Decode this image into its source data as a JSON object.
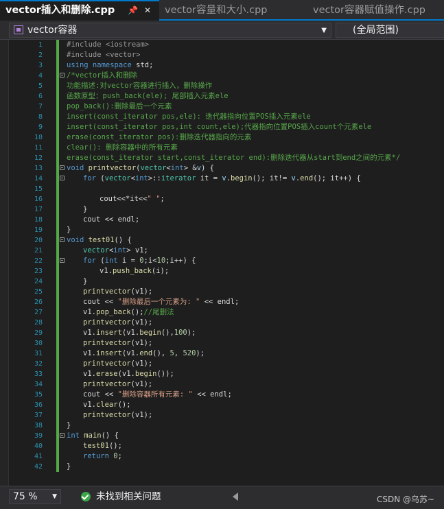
{
  "tabs": [
    {
      "label": "vector插入和删除.cpp",
      "active": true
    },
    {
      "label": "vector容量和大小.cpp",
      "active": false
    },
    {
      "label": "vector容器赋值操作.cpp",
      "active": false
    }
  ],
  "tab_icons": {
    "pin": "pin-icon",
    "close": "close-icon"
  },
  "nav": {
    "scope": "vector容器",
    "scope_icon": "project-icon",
    "global_scope": "(全局范围)"
  },
  "code": {
    "lines": [
      {
        "n": "1",
        "tokens": [
          [
            "pp",
            "#include <iostream>"
          ]
        ]
      },
      {
        "n": "2",
        "tokens": [
          [
            "pp",
            "#include <vector>"
          ]
        ]
      },
      {
        "n": "3",
        "tokens": [
          [
            "kw",
            "using namespace "
          ],
          [
            "",
            "std;"
          ]
        ]
      },
      {
        "n": "4",
        "fold": true,
        "tokens": [
          [
            "cm",
            "/*vector插入和删除"
          ]
        ]
      },
      {
        "n": "5",
        "tokens": [
          [
            "cm",
            "功能描述:对vector容器进行插入，删除操作"
          ]
        ]
      },
      {
        "n": "6",
        "tokens": [
          [
            "cm",
            "函数原型：push_back(ele); 尾部插入元素ele"
          ]
        ]
      },
      {
        "n": "7",
        "tokens": [
          [
            "cm",
            "pop_back():删除最后一个元素"
          ]
        ]
      },
      {
        "n": "8",
        "tokens": [
          [
            "cm",
            "insert(const_iterator pos,ele): 迭代器指向位置POS插入元素ele"
          ]
        ]
      },
      {
        "n": "9",
        "tokens": [
          [
            "cm",
            "insert(const_iterator pos,int count,ele);代器指向位置POS插入count个元素ele"
          ]
        ]
      },
      {
        "n": "10",
        "tokens": [
          [
            "cm",
            "erase(const_iterator pos):删除迭代器指向的元素"
          ]
        ]
      },
      {
        "n": "11",
        "tokens": [
          [
            "cm",
            "clear(): 删除容器中的所有元素"
          ]
        ]
      },
      {
        "n": "12",
        "tokens": [
          [
            "cm",
            "erase(const_iterator start,const_iterator end):删除迭代器从start到end之间的元素*/"
          ]
        ]
      },
      {
        "n": "13",
        "fold": true,
        "tokens": [
          [
            "kw",
            "void "
          ],
          [
            "fn",
            "printvector"
          ],
          [
            "",
            "("
          ],
          [
            "ty",
            "vector"
          ],
          [
            "",
            "<"
          ],
          [
            "kw",
            "int"
          ],
          [
            "",
            "> &"
          ],
          [
            "vr",
            "v"
          ],
          [
            "",
            ") {"
          ]
        ]
      },
      {
        "n": "14",
        "fold": true,
        "indent": 1,
        "tokens": [
          [
            "kw",
            "for "
          ],
          [
            "",
            "("
          ],
          [
            "ty",
            "vector"
          ],
          [
            "",
            "<"
          ],
          [
            "kw",
            "int"
          ],
          [
            "",
            ">::"
          ],
          [
            "ty",
            "iterator "
          ],
          [
            "",
            "it = "
          ],
          [
            "vr",
            "v"
          ],
          [
            "",
            "."
          ],
          [
            "fn",
            "begin"
          ],
          [
            "",
            "(); it!= "
          ],
          [
            "vr",
            "v"
          ],
          [
            "",
            "."
          ],
          [
            "fn",
            "end"
          ],
          [
            "",
            "(); it++) {"
          ]
        ]
      },
      {
        "n": "15",
        "tokens": []
      },
      {
        "n": "16",
        "indent": 2,
        "tokens": [
          [
            "",
            "cout<<*it<<"
          ],
          [
            "st",
            "\" \""
          ],
          [
            "",
            ";"
          ]
        ]
      },
      {
        "n": "17",
        "indent": 1,
        "tokens": [
          [
            "",
            "}"
          ]
        ]
      },
      {
        "n": "18",
        "indent": 1,
        "tokens": [
          [
            "",
            "cout << endl;"
          ]
        ]
      },
      {
        "n": "19",
        "tokens": [
          [
            "",
            "}"
          ]
        ]
      },
      {
        "n": "20",
        "fold": true,
        "tokens": [
          [
            "kw",
            "void "
          ],
          [
            "fn",
            "test01"
          ],
          [
            "",
            "() {"
          ]
        ]
      },
      {
        "n": "21",
        "indent": 1,
        "tokens": [
          [
            "ty",
            "vector"
          ],
          [
            "",
            "<"
          ],
          [
            "kw",
            "int"
          ],
          [
            "",
            "> v1;"
          ]
        ]
      },
      {
        "n": "22",
        "fold": true,
        "indent": 1,
        "tokens": [
          [
            "kw",
            "for "
          ],
          [
            "",
            "("
          ],
          [
            "kw",
            "int "
          ],
          [
            "",
            "i = "
          ],
          [
            "nm",
            "0"
          ],
          [
            "",
            ";i<"
          ],
          [
            "nm",
            "10"
          ],
          [
            "",
            ";i++) {"
          ]
        ]
      },
      {
        "n": "23",
        "indent": 2,
        "tokens": [
          [
            "",
            "v1."
          ],
          [
            "fn",
            "push_back"
          ],
          [
            "",
            "(i);"
          ]
        ]
      },
      {
        "n": "24",
        "indent": 1,
        "tokens": [
          [
            "",
            "}"
          ]
        ]
      },
      {
        "n": "25",
        "indent": 1,
        "tokens": [
          [
            "fn",
            "printvector"
          ],
          [
            "",
            "(v1);"
          ]
        ]
      },
      {
        "n": "26",
        "indent": 1,
        "tokens": [
          [
            "",
            "cout << "
          ],
          [
            "st",
            "\"删除最后一个元素为: \""
          ],
          [
            "",
            " << endl;"
          ]
        ]
      },
      {
        "n": "27",
        "indent": 1,
        "tokens": [
          [
            "",
            "v1."
          ],
          [
            "fn",
            "pop_back"
          ],
          [
            "",
            "();"
          ],
          [
            "cm",
            "//尾删法"
          ]
        ]
      },
      {
        "n": "28",
        "indent": 1,
        "tokens": [
          [
            "fn",
            "printvector"
          ],
          [
            "",
            "(v1);"
          ]
        ]
      },
      {
        "n": "29",
        "indent": 1,
        "tokens": [
          [
            "",
            "v1."
          ],
          [
            "fn",
            "insert"
          ],
          [
            "",
            "(v1."
          ],
          [
            "fn",
            "begin"
          ],
          [
            "",
            "(),"
          ],
          [
            "nm",
            "100"
          ],
          [
            "",
            ");"
          ]
        ]
      },
      {
        "n": "30",
        "indent": 1,
        "tokens": [
          [
            "fn",
            "printvector"
          ],
          [
            "",
            "(v1);"
          ]
        ]
      },
      {
        "n": "31",
        "indent": 1,
        "tokens": [
          [
            "",
            "v1."
          ],
          [
            "fn",
            "insert"
          ],
          [
            "",
            "(v1."
          ],
          [
            "fn",
            "end"
          ],
          [
            "",
            "(), "
          ],
          [
            "nm",
            "5"
          ],
          [
            "",
            ", "
          ],
          [
            "nm",
            "520"
          ],
          [
            "",
            ");"
          ]
        ]
      },
      {
        "n": "32",
        "indent": 1,
        "tokens": [
          [
            "fn",
            "printvector"
          ],
          [
            "",
            "(v1);"
          ]
        ]
      },
      {
        "n": "33",
        "indent": 1,
        "tokens": [
          [
            "",
            "v1."
          ],
          [
            "fn",
            "erase"
          ],
          [
            "",
            "(v1."
          ],
          [
            "fn",
            "begin"
          ],
          [
            "",
            "());"
          ]
        ]
      },
      {
        "n": "34",
        "indent": 1,
        "tokens": [
          [
            "fn",
            "printvector"
          ],
          [
            "",
            "(v1);"
          ]
        ]
      },
      {
        "n": "35",
        "indent": 1,
        "tokens": [
          [
            "",
            "cout << "
          ],
          [
            "st",
            "\"删除容器所有元素: \""
          ],
          [
            "",
            " << endl;"
          ]
        ]
      },
      {
        "n": "36",
        "indent": 1,
        "tokens": [
          [
            "",
            "v1."
          ],
          [
            "fn",
            "clear"
          ],
          [
            "",
            "();"
          ]
        ]
      },
      {
        "n": "37",
        "indent": 1,
        "tokens": [
          [
            "fn",
            "printvector"
          ],
          [
            "",
            "(v1);"
          ]
        ]
      },
      {
        "n": "38",
        "tokens": [
          [
            "",
            "}"
          ]
        ]
      },
      {
        "n": "39",
        "fold": true,
        "tokens": [
          [
            "kw",
            "int "
          ],
          [
            "fn",
            "main"
          ],
          [
            "",
            "() {"
          ]
        ]
      },
      {
        "n": "40",
        "indent": 1,
        "tokens": [
          [
            "fn",
            "test01"
          ],
          [
            "",
            "();"
          ]
        ]
      },
      {
        "n": "41",
        "indent": 1,
        "tokens": [
          [
            "kw",
            "return "
          ],
          [
            "nm",
            "0"
          ],
          [
            "",
            ";"
          ]
        ]
      },
      {
        "n": "42",
        "tokens": [
          [
            "",
            "}"
          ]
        ]
      }
    ]
  },
  "status": {
    "zoom": "75 %",
    "issues": "未找到相关问题",
    "issues_icon": "check-circle-icon",
    "watermark": "CSDN @乌苏~"
  },
  "colors": {
    "editor_bg": "#1e1e1e",
    "keyword": "#569cd6",
    "comment": "#57a64a",
    "string": "#d69d85",
    "function": "#dcdcaa",
    "type": "#4ec9b0",
    "number": "#b5cea8",
    "line_number": "#2b91af",
    "accent": "#007acc"
  }
}
